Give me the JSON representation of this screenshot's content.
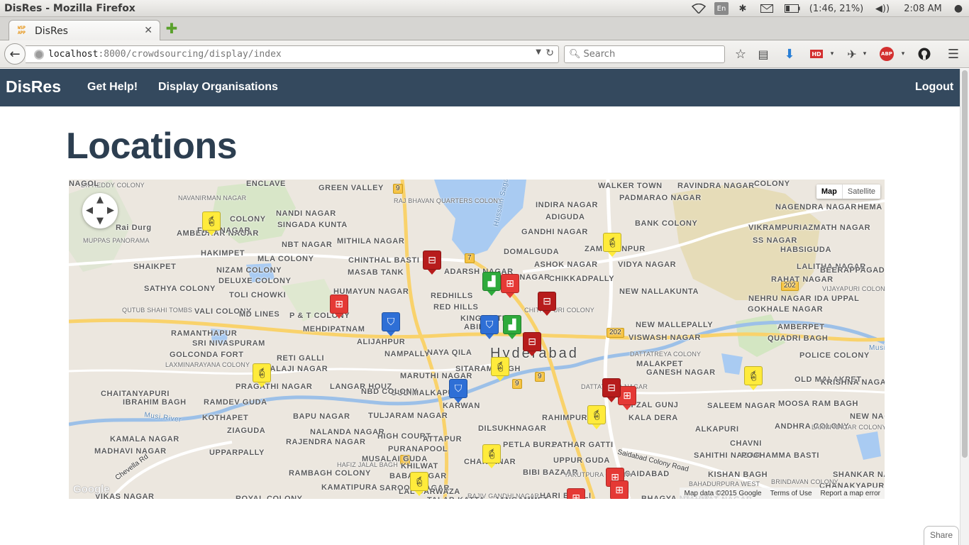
{
  "os": {
    "window_title": "DisRes - Mozilla Firefox",
    "keyboard_layout": "En",
    "battery": "(1:46, 21%)",
    "clock": "2:08 AM"
  },
  "browser": {
    "tab_title": "DisRes",
    "favicon_text": "WSP APP",
    "url_host": "localhost",
    "url_rest": ":8000/crowdsourcing/display/index",
    "search_placeholder": "Search",
    "toolbar_badges": {
      "hd": "HD",
      "abp": "ABP"
    }
  },
  "site_nav": {
    "brand": "DisRes",
    "links": [
      "Get Help!",
      "Display Organisations"
    ],
    "logout": "Logout"
  },
  "page": {
    "title": "Locations"
  },
  "map": {
    "type_buttons": [
      "Map",
      "Satellite"
    ],
    "city_label": "Hyderabad",
    "google_logo": "Google",
    "footer": [
      "Map data ©2015 Google",
      "Terms of Use",
      "Report a map error"
    ],
    "road_shields": [
      "9",
      "9",
      "7",
      "7",
      "9",
      "202",
      "202"
    ],
    "area_labels": [
      "BN REDDY COLONY",
      "NAVANIRMAN NAGAR",
      "ENCLAVE",
      "GREEN VALLEY",
      "RAJ BHAVAN QUARTERS COLONY",
      "WALKER TOWN",
      "PADMARAO NAGAR",
      "RAVINDRA NAGAR",
      "COLONY",
      "NAGENDRA NAGAR",
      "NANDI NAGAR",
      "SINGADA KUNTA",
      "INDIRA NAGAR",
      "ADIGUDA",
      "BANK COLONY",
      "AMBEDKAR NAGAR",
      "FILM NAGAR",
      "COLONY",
      "Rai Durg",
      "MITHILA NAGAR",
      "GANDHI NAGAR",
      "VIKRAMPURI",
      "AZMATH NAGAR",
      "HEMA NAGAR",
      "MUPPAS PANORAMA",
      "HAKIMPET",
      "NBT NAGAR",
      "DOMALGUDA",
      "ZAMISTANPUR",
      "SS NAGAR",
      "HABSIGUDA",
      "MLA COLONY",
      "CHINTHAL BASTI",
      "ASHOK NAGAR",
      "VIDYA NAGAR",
      "SHAIKPET",
      "NIZAM COLONY",
      "ADARSH NAGAR",
      "LALITHA NAGAR",
      "BEERAPPAGADDA",
      "DELUXE COLONY",
      "MASAB TANK",
      "CHIKKADPALLY",
      "RAHAT NAGAR",
      "TOLI CHOWKI",
      "HUMAYUN NAGAR",
      "NEW NALLAKUNTA",
      "VIJAYAPURI COLONY",
      "SATHYA COLONY",
      "REDHILLS",
      "RED HILLS",
      "TNAGAR",
      "NEHRU NAGAR",
      "IDA UPPAL",
      "QUTUB SHAHI TOMBS",
      "VALI COLONY",
      "MD LINES",
      "P & T COLONY",
      "KING KOTI",
      "CHITRAPURI COLONY",
      "GOKHALE NAGAR",
      "MEHDIPATNAM",
      "ABIDS",
      "NEW MALLEPALLY",
      "AMBERPET",
      "RAMANTHAPUR",
      "ALIJAHPUR",
      "VISWASH NAGAR",
      "QUADRI BAGH",
      "SRI NIVASPURAM",
      "NAYA QILA",
      "NAMPALLY",
      "DATTATREYA COLONY",
      "POLICE COLONY",
      "LAXMINARAYANA COLONY",
      "GOLCONDA FORT",
      "RETI GALLI",
      "BALAJI NAGAR",
      "MARUTHI NAGAR",
      "SITARAM BAGH",
      "MALAKPET",
      "GANESH NAGAR",
      "PRAGATHI NAGAR",
      "LANGAR HOUZ",
      "GUDIMALKAPUR",
      "DATTATREYA NAGAR",
      "OLD MALAKPET",
      "KRISHNA NAGAR",
      "CHAITANYAPURI",
      "IBRAHIM BAGH",
      "RAMDEV GUDA",
      "KARWAN",
      "AFZAL GUNJ",
      "SALEEM NAGAR",
      "MOOSA RAM BAGH",
      "KOTHAPET",
      "BAPU NAGAR",
      "NBD COLONY",
      "TULJARAM NAGAR",
      "RAHIMPURA",
      "KALA DERA",
      "ANDHRA COLONY",
      "LAXMI NAGAR COLONY",
      "ALKAPURI",
      "DILSUKHNAGAR",
      "HIGH COURT",
      "ZIAGUDA",
      "NALANDA NAGAR",
      "ATTAPUR",
      "PETLA BURZ",
      "PATHAR GATTI",
      "CHAVNI",
      "KAMALA NAGAR",
      "MADHAVI NAGAR",
      "RAJENDRA NAGAR",
      "PURANAPOOL",
      "SAHITHI NAGAR",
      "POCHAMMA BASTI",
      "UPPARPALLY",
      "MUSALAI GUDA",
      "HAFIZ JALAL BAGH",
      "CHARMINAR",
      "UPPUR GUDA",
      "SAIDABAD",
      "KHILWAT",
      "BIBI BAZAAR",
      "YAKUTPURA COLONY",
      "RAMBAGH COLONY",
      "BABA NAGAR",
      "BAHADURPURA WEST",
      "SAROOR NAGAR",
      "KISHAN BAGH",
      "KAMATIPURA",
      "LAL DARWAZA",
      "SHANKAR NAGAR",
      "CHANAKYAPURI",
      "VIKAS NAGAR",
      "ROYAL COLONY",
      "RAJIV GANDHI NAGAR",
      "HARI BOWLI",
      "TALAB KATTA",
      "JANGAMMET",
      "BHAGYA NAGAR",
      "RAHMAT NAGAR",
      "BRINDAVAN COLONY",
      "NEW NAGAR",
      "NAGOL"
    ],
    "water_labels": [
      "Hussain Sagar",
      "Musi River",
      "Musi"
    ],
    "road_labels": [
      "Chevella Rd",
      "Saidabad Colony Road"
    ],
    "marker_types": {
      "fire": {
        "color": "#ffeb3b",
        "icon": "fire-extinguisher-icon"
      },
      "hospital": {
        "color": "#e53935",
        "icon": "hospital-icon"
      },
      "blood_bank": {
        "color": "#b71c1c",
        "icon": "blood-bank-icon"
      },
      "police": {
        "color": "#2e6fd6",
        "icon": "police-shield-icon"
      },
      "factory": {
        "color": "#2eaa3c",
        "icon": "factory-icon"
      }
    },
    "marker_count": 24
  },
  "share": "Share"
}
